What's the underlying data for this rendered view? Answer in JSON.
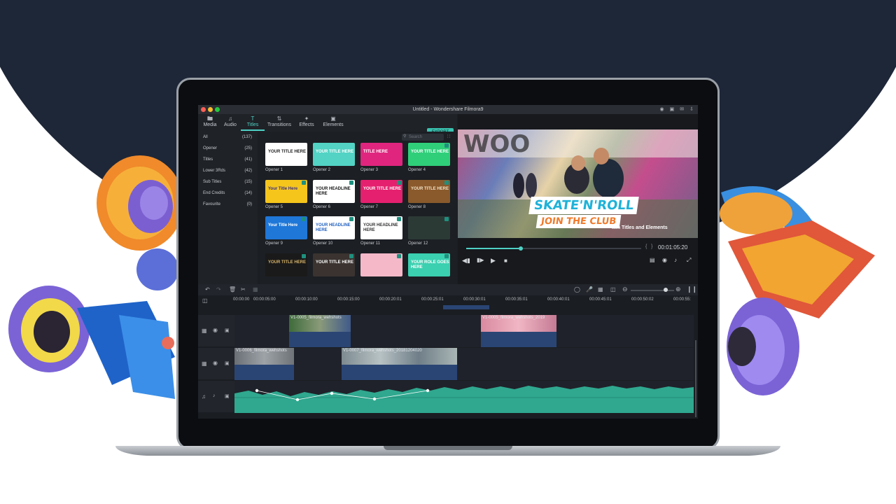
{
  "window": {
    "title": "Untitled - Wondershare Filmora9"
  },
  "toolbar": {
    "tabs": [
      {
        "label": "Media",
        "icon": "folder-icon"
      },
      {
        "label": "Audio",
        "icon": "music-note-icon"
      },
      {
        "label": "Titles",
        "icon": "text-icon"
      },
      {
        "label": "Transitions",
        "icon": "transition-icon"
      },
      {
        "label": "Effects",
        "icon": "effects-icon"
      },
      {
        "label": "Elements",
        "icon": "image-icon"
      }
    ],
    "export_label": "EXPORT"
  },
  "categories": [
    {
      "label": "All",
      "count": "(137)"
    },
    {
      "label": "Opener",
      "count": "(25)"
    },
    {
      "label": "Titles",
      "count": "(41)"
    },
    {
      "label": "Lower 3Rds",
      "count": "(42)"
    },
    {
      "label": "Sub Titles",
      "count": "(15)"
    },
    {
      "label": "End Credits",
      "count": "(14)"
    },
    {
      "label": "Favourite",
      "count": "(0)"
    }
  ],
  "search": {
    "placeholder": "Search"
  },
  "library": {
    "items": [
      {
        "label": "Opener 1",
        "text": "YOUR TITLE HERE",
        "bg": "#ffffff",
        "fg": "#222222"
      },
      {
        "label": "Opener 2",
        "text": "YOUR TITLE HERE",
        "bg": "#52d3c4",
        "fg": "#ffffff"
      },
      {
        "label": "Opener 3",
        "text": "TITLE HERE",
        "bg": "#e0257f",
        "fg": "#ffffff"
      },
      {
        "label": "Opener 4",
        "text": "YOUR TITLE HERE",
        "bg": "#2fcf7a",
        "fg": "#ffffff"
      },
      {
        "label": "Opener 5",
        "text": "Your Title Here",
        "bg": "#f5c51c",
        "fg": "#3a2f8a"
      },
      {
        "label": "Opener 6",
        "text": "YOUR HEADLINE HERE",
        "bg": "#ffffff",
        "fg": "#111111"
      },
      {
        "label": "Opener 7",
        "text": "YOUR TITLE HERE",
        "bg": "#e5206e",
        "fg": "#ffffff"
      },
      {
        "label": "Opener 8",
        "text": "YOUR TITLE HERE",
        "bg": "#8a5a2c",
        "fg": "#f2e3c8"
      },
      {
        "label": "Opener 9",
        "text": "Your Title Here",
        "bg": "#1f77d8",
        "fg": "#ffffff"
      },
      {
        "label": "Opener 10",
        "text": "YOUR HEADLINE HERE",
        "bg": "#ffffff",
        "fg": "#1f5fbf"
      },
      {
        "label": "Opener 11",
        "text": "YOUR HEADLINE HERE",
        "bg": "#ffffff",
        "fg": "#333333"
      },
      {
        "label": "Opener 12",
        "text": "",
        "bg": "#2c3a36",
        "fg": "#b8e3d6"
      },
      {
        "label": "",
        "text": "YOUR TITLE HERE",
        "bg": "#1a1a1a",
        "fg": "#d8b56a"
      },
      {
        "label": "",
        "text": "YOUR TITLE HERE",
        "bg": "#3a3330",
        "fg": "#ffffff"
      },
      {
        "label": "",
        "text": "",
        "bg": "#f4b8c8",
        "fg": "#ffffff"
      },
      {
        "label": "",
        "text": "YOUR ROLE GOES HERE",
        "bg": "#3ad0b0",
        "fg": "#ffffff"
      }
    ]
  },
  "preview": {
    "overlay_title": "SKATE'N'ROLL",
    "overlay_subtitle": "JOIN THE CLUB",
    "caption": "...m Titles and Elements",
    "timecode": "00:01:05:20",
    "progress": 0.31
  },
  "timeline": {
    "ruler": [
      "00:00:00",
      "00:00:05:00",
      "00:00:10:00",
      "00:00:15:00",
      "00:00:20:01",
      "00:00:25:01",
      "00:00:30:01",
      "00:00:35:01",
      "00:00:40:01",
      "00:00:45:01",
      "00:00:50:02",
      "00:00:55:"
    ],
    "clips_v2": [
      {
        "label": "V1-0005_filmora_wehshots"
      },
      {
        "label": "V1-0005_filmora_wehshots_2019"
      }
    ],
    "clips_v1": [
      {
        "label": "V1-0006_filmora_wehshots"
      },
      {
        "label": "V1-0007_filmora_wehshots_20181204020"
      }
    ],
    "zoom": 0.8
  }
}
